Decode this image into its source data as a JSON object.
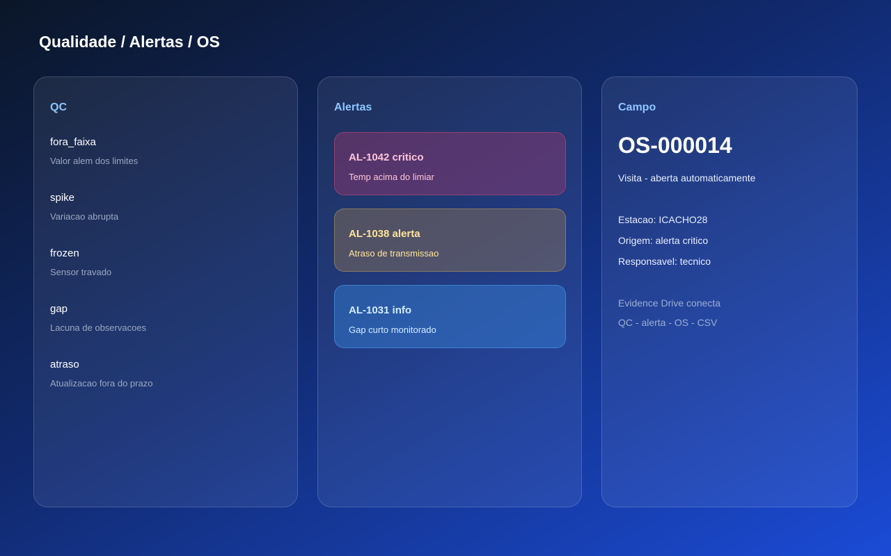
{
  "page": {
    "title": "Qualidade / Alertas / OS"
  },
  "qc": {
    "heading": "QC",
    "items": [
      {
        "name": "fora_faixa",
        "description": "Valor alem dos limites"
      },
      {
        "name": "spike",
        "description": "Variacao abrupta"
      },
      {
        "name": "frozen",
        "description": "Sensor travado"
      },
      {
        "name": "gap",
        "description": "Lacuna de observacoes"
      },
      {
        "name": "atraso",
        "description": "Atualizacao fora do prazo"
      }
    ]
  },
  "alerts": {
    "heading": "Alertas",
    "items": [
      {
        "title": "AL-1042 critico",
        "description": "Temp acima do limiar",
        "severity": "critico",
        "color": "#ffc4d8"
      },
      {
        "title": "AL-1038 alerta",
        "description": "Atraso de transmissao",
        "severity": "alerta",
        "color": "#ffe49a"
      },
      {
        "title": "AL-1031 info",
        "description": "Gap curto monitorado",
        "severity": "info",
        "color": "#d2ecff"
      }
    ]
  },
  "campo": {
    "heading": "Campo",
    "os_id": "OS-000014",
    "os_description": "Visita - aberta automaticamente",
    "station": "Estacao: ICACHO28",
    "origin": "Origem: alerta critico",
    "responsible": "Responsavel: tecnico",
    "footer_line1": "Evidence Drive conecta",
    "footer_line2": "QC - alerta - OS - CSV"
  },
  "colors": {
    "accent_heading": "#8ec5ff",
    "background_start": "#0b1628",
    "background_end": "#1b4bd6"
  }
}
